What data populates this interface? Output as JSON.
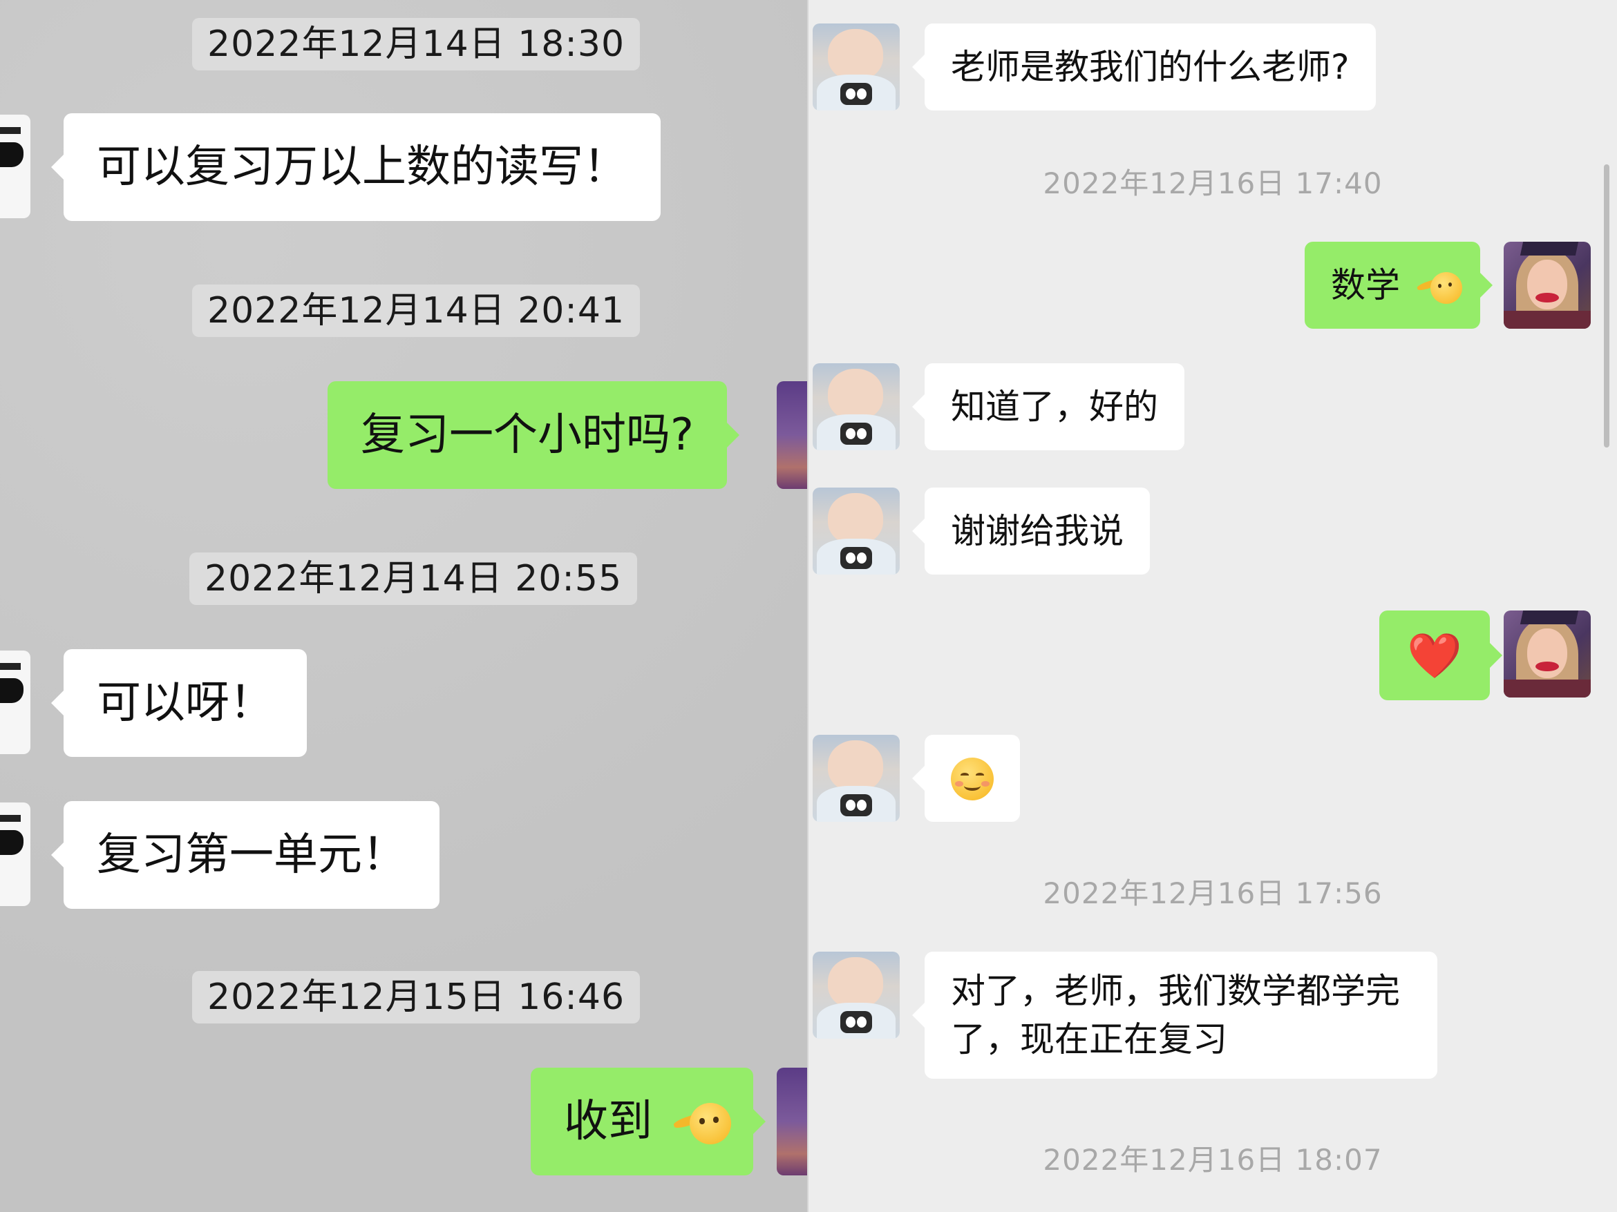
{
  "left_panel": {
    "timestamps": [
      "2022年12月14日 18:30",
      "2022年12月14日 20:41",
      "2022年12月14日 20:55",
      "2022年12月15日 16:46"
    ],
    "messages": [
      {
        "side": "received",
        "text": "可以复习万以上数的读写！"
      },
      {
        "side": "sent",
        "text": "复习一个小时吗?"
      },
      {
        "side": "received",
        "text": "可以呀！"
      },
      {
        "side": "received",
        "text": "复习第一单元！"
      },
      {
        "side": "sent",
        "text": "收到",
        "emoji": "salute-emoji"
      }
    ]
  },
  "right_panel": {
    "timestamps": [
      "2022年12月16日 17:40",
      "2022年12月16日 17:56",
      "2022年12月16日 18:07"
    ],
    "messages": [
      {
        "side": "received",
        "text": "老师是教我们的什么老师?"
      },
      {
        "side": "sent",
        "text": "数学",
        "emoji": "salute-emoji"
      },
      {
        "side": "received",
        "text": "知道了，好的"
      },
      {
        "side": "received",
        "text": "谢谢给我说"
      },
      {
        "side": "sent",
        "text": "❤️",
        "emoji": "heart-emoji"
      },
      {
        "side": "received",
        "text": "",
        "emoji": "smile-emoji"
      },
      {
        "side": "received",
        "text": "对了，老师，我们数学都学完了，现在正在复习"
      }
    ]
  },
  "colors": {
    "sent_bubble": "#95ec69",
    "received_bubble": "#ffffff",
    "left_background": "#c9c9c9",
    "right_background": "#ededed",
    "timestamp_text_right": "#a8a8a8"
  }
}
